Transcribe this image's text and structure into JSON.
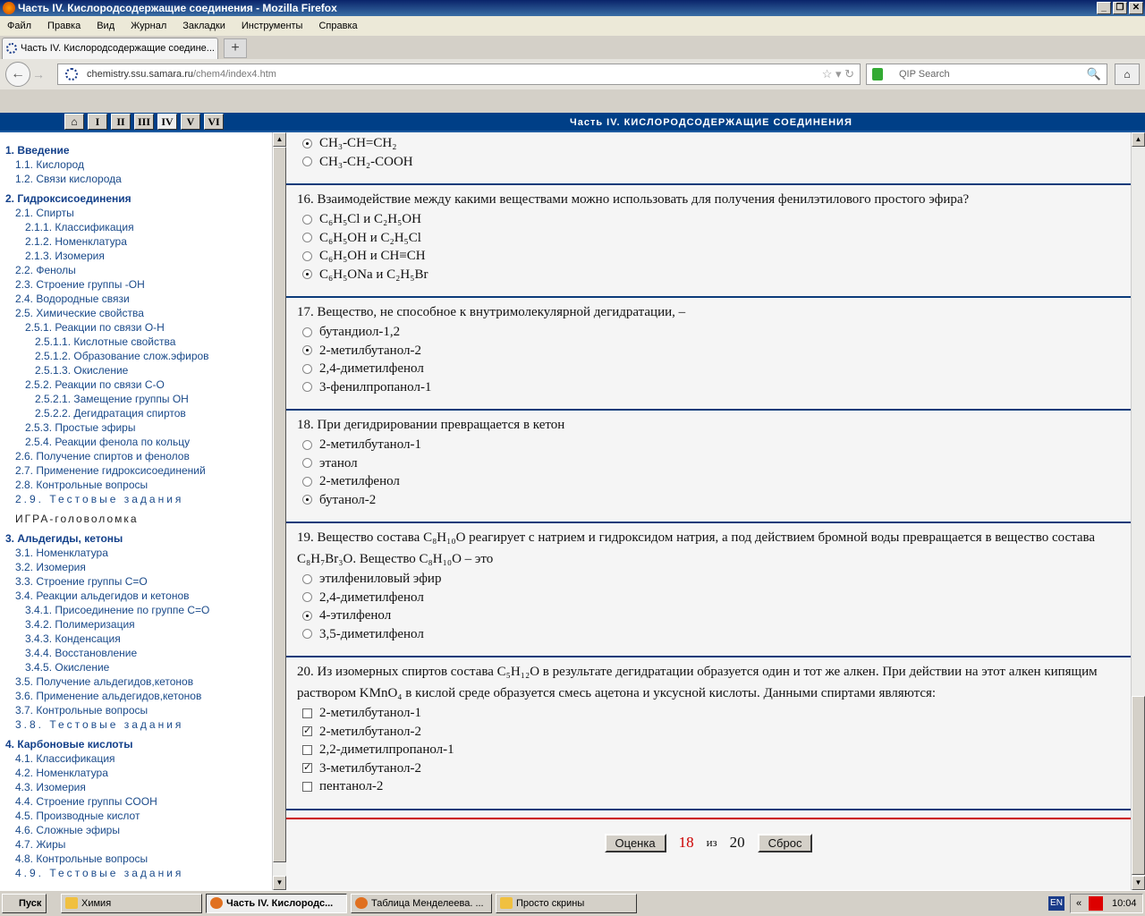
{
  "window": {
    "title": "Часть IV. Кислородсодержащие соединения - Mozilla Firefox",
    "controls": [
      "_",
      "❐",
      "✕"
    ]
  },
  "menu": [
    "Файл",
    "Правка",
    "Вид",
    "Журнал",
    "Закладки",
    "Инструменты",
    "Справка"
  ],
  "tab": {
    "label": "Часть IV. Кислородсодержащие соедине...",
    "new": "+"
  },
  "nav": {
    "url_host": "chemistry.ssu.samara.ru",
    "url_path": "/chem4/index4.htm",
    "search_placeholder": "QIP Search",
    "back": "←",
    "forward": "→"
  },
  "header": {
    "parts": [
      "⌂",
      "I",
      "II",
      "III",
      "IV",
      "V",
      "VI"
    ],
    "current": "IV",
    "title": "Часть IV.  КИСЛОРОДСОДЕРЖАЩИЕ СОЕДИНЕНИЯ"
  },
  "sidebar": [
    {
      "t": "1. Введение",
      "l": 0,
      "h": 1
    },
    {
      "t": "1.1. Кислород",
      "l": 1
    },
    {
      "t": "1.2. Связи кислорода",
      "l": 1
    },
    {
      "t": "2. Гидроксисоединения",
      "l": 0,
      "h": 1
    },
    {
      "t": "2.1. Спирты",
      "l": 1
    },
    {
      "t": "2.1.1. Классификация",
      "l": 2
    },
    {
      "t": "2.1.2. Номенклатура",
      "l": 2
    },
    {
      "t": "2.1.3. Изомерия",
      "l": 2
    },
    {
      "t": "2.2. Фенолы",
      "l": 1
    },
    {
      "t": "2.3. Строение группы -OH",
      "l": 1
    },
    {
      "t": "2.4. Водородные связи",
      "l": 1
    },
    {
      "t": "2.5. Химические свойства",
      "l": 1
    },
    {
      "t": "2.5.1. Реакции по связи O-H",
      "l": 2
    },
    {
      "t": "2.5.1.1. Кислотные свойства",
      "l": 3
    },
    {
      "t": "2.5.1.2. Образование слож.эфиров",
      "l": 3
    },
    {
      "t": "2.5.1.3. Окисление",
      "l": 3
    },
    {
      "t": "2.5.2. Реакции по связи C-O",
      "l": 2
    },
    {
      "t": "2.5.2.1. Замещение группы OH",
      "l": 3
    },
    {
      "t": "2.5.2.2. Дегидратация спиртов",
      "l": 3
    },
    {
      "t": "2.5.3. Простые эфиры",
      "l": 2
    },
    {
      "t": "2.5.4. Реакции фенола по кольцу",
      "l": 2
    },
    {
      "t": "2.6. Получение спиртов и фенолов",
      "l": 1
    },
    {
      "t": "2.7. Применение гидроксисоединений",
      "l": 1
    },
    {
      "t": "2.8. Контрольные вопросы",
      "l": 1
    },
    {
      "t": "2.9. Тестовые задания",
      "l": 1,
      "sp": 1
    },
    {
      "t": "ИГРА-головоломка",
      "l": 1,
      "game": 1
    },
    {
      "t": "3. Альдегиды, кетоны",
      "l": 0,
      "h": 1
    },
    {
      "t": "3.1. Номенклатура",
      "l": 1
    },
    {
      "t": "3.2. Изомерия",
      "l": 1
    },
    {
      "t": "3.3. Строение группы C=O",
      "l": 1
    },
    {
      "t": "3.4. Реакции альдегидов и кетонов",
      "l": 1
    },
    {
      "t": "3.4.1. Присоединение по группе C=O",
      "l": 2
    },
    {
      "t": "3.4.2. Полимеризация",
      "l": 2
    },
    {
      "t": "3.4.3. Конденсация",
      "l": 2
    },
    {
      "t": "3.4.4. Восстановление",
      "l": 2
    },
    {
      "t": "3.4.5. Окисление",
      "l": 2
    },
    {
      "t": "3.5. Получение альдегидов,кетонов",
      "l": 1
    },
    {
      "t": "3.6. Применение альдегидов,кетонов",
      "l": 1
    },
    {
      "t": "3.7. Контрольные вопросы",
      "l": 1
    },
    {
      "t": "3.8. Тестовые задания",
      "l": 1,
      "sp": 1
    },
    {
      "t": "4. Карбоновые кислоты",
      "l": 0,
      "h": 1
    },
    {
      "t": "4.1. Классификация",
      "l": 1
    },
    {
      "t": "4.2. Номенклатура",
      "l": 1
    },
    {
      "t": "4.3. Изомерия",
      "l": 1
    },
    {
      "t": "4.4. Строение группы COOH",
      "l": 1
    },
    {
      "t": "4.5. Производные кислот",
      "l": 1
    },
    {
      "t": "4.6. Сложные эфиры",
      "l": 1
    },
    {
      "t": "4.7. Жиры",
      "l": 1
    },
    {
      "t": "4.8. Контрольные вопросы",
      "l": 1
    },
    {
      "t": "4.9. Тестовые задания",
      "l": 1,
      "sp": 1
    }
  ],
  "questions": [
    {
      "text": "",
      "type": "radio",
      "options": [
        {
          "t": "CH₃-CH=CH₂",
          "c": true
        },
        {
          "t": "CH₃-CH₂-COOH",
          "c": false
        }
      ]
    },
    {
      "text": "16. Взаимодействие между какими веществами можно использовать для получения фенилэтилового простого эфира?",
      "type": "radio",
      "options": [
        {
          "t": "C₆H₅Cl и C₂H₅OH",
          "c": false
        },
        {
          "t": "C₆H₅OH и C₂H₅Cl",
          "c": false
        },
        {
          "t": "C₆H₅OH и CH≡CH",
          "c": false
        },
        {
          "t": "C₆H₅ONa и C₂H₅Br",
          "c": true
        }
      ]
    },
    {
      "text": "17. Вещество, не способное к внутримолекулярной дегидратации, –",
      "type": "radio",
      "options": [
        {
          "t": "бутандиол-1,2",
          "c": false
        },
        {
          "t": "2-метилбутанол-2",
          "c": true
        },
        {
          "t": "2,4-диметилфенол",
          "c": false
        },
        {
          "t": "3-фенилпропанол-1",
          "c": false
        }
      ]
    },
    {
      "text": "18. При дегидрировании превращается в кетон",
      "type": "radio",
      "options": [
        {
          "t": "2-метилбутанол-1",
          "c": false
        },
        {
          "t": "этанол",
          "c": false
        },
        {
          "t": "2-метилфенол",
          "c": false
        },
        {
          "t": "бутанол-2",
          "c": true
        }
      ]
    },
    {
      "text": "19. Вещество состава C₈H₁₀O реагирует с натрием и гидроксидом натрия, а под действием бромной воды превращается в вещество состава C₈H₇Br₃O. Вещество C₈H₁₀O – это",
      "type": "radio",
      "options": [
        {
          "t": "этилфениловый эфир",
          "c": false
        },
        {
          "t": "2,4-диметилфенол",
          "c": false
        },
        {
          "t": "4-этилфенол",
          "c": true
        },
        {
          "t": "3,5-диметилфенол",
          "c": false
        }
      ]
    },
    {
      "text": "20. Из изомерных спиртов состава C₅H₁₂O в результате дегидратации образуется один и тот же алкен. При действии на этот алкен кипящим раствором KMnO₄ в кислой среде образуется смесь ацетона и уксусной кислоты. Данными спиртами являются:",
      "type": "check",
      "options": [
        {
          "t": "2-метилбутанол-1",
          "c": false
        },
        {
          "t": "2-метилбутанол-2",
          "c": true
        },
        {
          "t": "2,2-диметилпропанол-1",
          "c": false
        },
        {
          "t": "3-метилбутанол-2",
          "c": true
        },
        {
          "t": "пентанол-2",
          "c": false
        }
      ]
    }
  ],
  "footer": {
    "grade_button": "Оценка",
    "score": "18",
    "of": "из",
    "total": "20",
    "reset_button": "Сброс"
  },
  "taskbar": {
    "start": "Пуск",
    "items": [
      "Химия",
      "Часть IV. Кислородс...",
      "Таблица Менделеева. ...",
      "Просто скрины"
    ],
    "lang": "EN",
    "tray_arrows": "«",
    "clock": "10:04"
  },
  "colors": {
    "header": "#003f87",
    "score": "#cc0000",
    "link": "#1a4a8a"
  }
}
